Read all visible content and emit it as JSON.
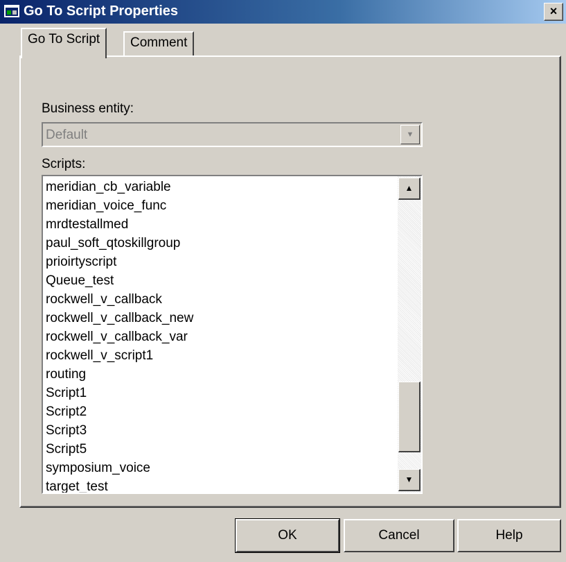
{
  "window": {
    "title": "Go To Script Properties",
    "close_glyph": "×"
  },
  "tabs": [
    {
      "label": "Go To Script",
      "active": true
    },
    {
      "label": "Comment",
      "active": false
    }
  ],
  "business_entity": {
    "label": "Business entity:",
    "value": "Default"
  },
  "scripts": {
    "label": "Scripts:",
    "items": [
      "meridian_cb_variable",
      "meridian_voice_func",
      "mrdtestallmed",
      "paul_soft_qtoskillgroup",
      "prioirtyscript",
      "Queue_test",
      "rockwell_v_callback",
      "rockwell_v_callback_new",
      "rockwell_v_callback_var",
      "rockwell_v_script1",
      "routing",
      "Script1",
      "Script2",
      "Script3",
      "Script5",
      "symposium_voice",
      "target_test"
    ],
    "scroll_up_glyph": "▲",
    "scroll_down_glyph": "▼"
  },
  "buttons": {
    "ok": "OK",
    "cancel": "Cancel",
    "help": "Help"
  },
  "icons": {
    "app": "window-app-icon",
    "dropdown": "chevron-down-icon"
  }
}
